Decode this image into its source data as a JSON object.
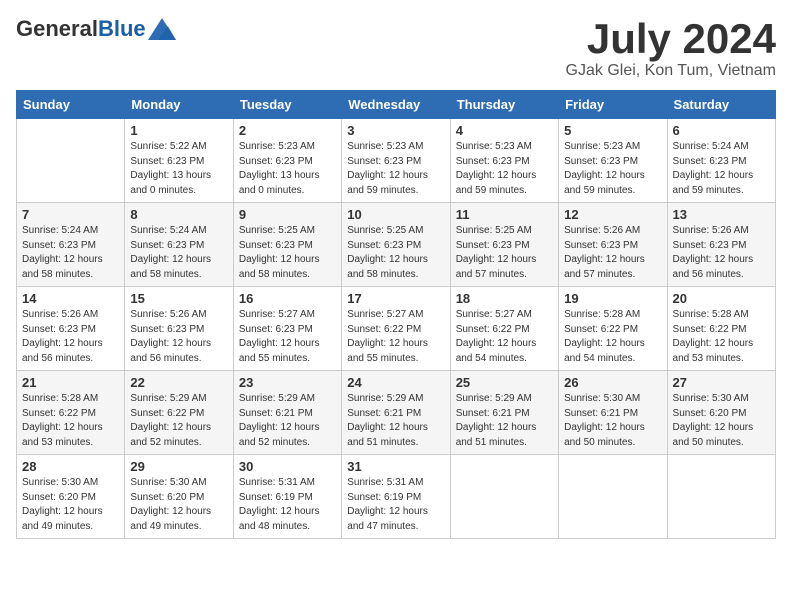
{
  "header": {
    "logo_general": "General",
    "logo_blue": "Blue",
    "month": "July 2024",
    "location": "GJak Glei, Kon Tum, Vietnam"
  },
  "weekdays": [
    "Sunday",
    "Monday",
    "Tuesday",
    "Wednesday",
    "Thursday",
    "Friday",
    "Saturday"
  ],
  "weeks": [
    [
      {
        "num": "",
        "info": ""
      },
      {
        "num": "1",
        "info": "Sunrise: 5:22 AM\nSunset: 6:23 PM\nDaylight: 13 hours\nand 0 minutes."
      },
      {
        "num": "2",
        "info": "Sunrise: 5:23 AM\nSunset: 6:23 PM\nDaylight: 13 hours\nand 0 minutes."
      },
      {
        "num": "3",
        "info": "Sunrise: 5:23 AM\nSunset: 6:23 PM\nDaylight: 12 hours\nand 59 minutes."
      },
      {
        "num": "4",
        "info": "Sunrise: 5:23 AM\nSunset: 6:23 PM\nDaylight: 12 hours\nand 59 minutes."
      },
      {
        "num": "5",
        "info": "Sunrise: 5:23 AM\nSunset: 6:23 PM\nDaylight: 12 hours\nand 59 minutes."
      },
      {
        "num": "6",
        "info": "Sunrise: 5:24 AM\nSunset: 6:23 PM\nDaylight: 12 hours\nand 59 minutes."
      }
    ],
    [
      {
        "num": "7",
        "info": "Sunrise: 5:24 AM\nSunset: 6:23 PM\nDaylight: 12 hours\nand 58 minutes."
      },
      {
        "num": "8",
        "info": "Sunrise: 5:24 AM\nSunset: 6:23 PM\nDaylight: 12 hours\nand 58 minutes."
      },
      {
        "num": "9",
        "info": "Sunrise: 5:25 AM\nSunset: 6:23 PM\nDaylight: 12 hours\nand 58 minutes."
      },
      {
        "num": "10",
        "info": "Sunrise: 5:25 AM\nSunset: 6:23 PM\nDaylight: 12 hours\nand 58 minutes."
      },
      {
        "num": "11",
        "info": "Sunrise: 5:25 AM\nSunset: 6:23 PM\nDaylight: 12 hours\nand 57 minutes."
      },
      {
        "num": "12",
        "info": "Sunrise: 5:26 AM\nSunset: 6:23 PM\nDaylight: 12 hours\nand 57 minutes."
      },
      {
        "num": "13",
        "info": "Sunrise: 5:26 AM\nSunset: 6:23 PM\nDaylight: 12 hours\nand 56 minutes."
      }
    ],
    [
      {
        "num": "14",
        "info": "Sunrise: 5:26 AM\nSunset: 6:23 PM\nDaylight: 12 hours\nand 56 minutes."
      },
      {
        "num": "15",
        "info": "Sunrise: 5:26 AM\nSunset: 6:23 PM\nDaylight: 12 hours\nand 56 minutes."
      },
      {
        "num": "16",
        "info": "Sunrise: 5:27 AM\nSunset: 6:23 PM\nDaylight: 12 hours\nand 55 minutes."
      },
      {
        "num": "17",
        "info": "Sunrise: 5:27 AM\nSunset: 6:22 PM\nDaylight: 12 hours\nand 55 minutes."
      },
      {
        "num": "18",
        "info": "Sunrise: 5:27 AM\nSunset: 6:22 PM\nDaylight: 12 hours\nand 54 minutes."
      },
      {
        "num": "19",
        "info": "Sunrise: 5:28 AM\nSunset: 6:22 PM\nDaylight: 12 hours\nand 54 minutes."
      },
      {
        "num": "20",
        "info": "Sunrise: 5:28 AM\nSunset: 6:22 PM\nDaylight: 12 hours\nand 53 minutes."
      }
    ],
    [
      {
        "num": "21",
        "info": "Sunrise: 5:28 AM\nSunset: 6:22 PM\nDaylight: 12 hours\nand 53 minutes."
      },
      {
        "num": "22",
        "info": "Sunrise: 5:29 AM\nSunset: 6:22 PM\nDaylight: 12 hours\nand 52 minutes."
      },
      {
        "num": "23",
        "info": "Sunrise: 5:29 AM\nSunset: 6:21 PM\nDaylight: 12 hours\nand 52 minutes."
      },
      {
        "num": "24",
        "info": "Sunrise: 5:29 AM\nSunset: 6:21 PM\nDaylight: 12 hours\nand 51 minutes."
      },
      {
        "num": "25",
        "info": "Sunrise: 5:29 AM\nSunset: 6:21 PM\nDaylight: 12 hours\nand 51 minutes."
      },
      {
        "num": "26",
        "info": "Sunrise: 5:30 AM\nSunset: 6:21 PM\nDaylight: 12 hours\nand 50 minutes."
      },
      {
        "num": "27",
        "info": "Sunrise: 5:30 AM\nSunset: 6:20 PM\nDaylight: 12 hours\nand 50 minutes."
      }
    ],
    [
      {
        "num": "28",
        "info": "Sunrise: 5:30 AM\nSunset: 6:20 PM\nDaylight: 12 hours\nand 49 minutes."
      },
      {
        "num": "29",
        "info": "Sunrise: 5:30 AM\nSunset: 6:20 PM\nDaylight: 12 hours\nand 49 minutes."
      },
      {
        "num": "30",
        "info": "Sunrise: 5:31 AM\nSunset: 6:19 PM\nDaylight: 12 hours\nand 48 minutes."
      },
      {
        "num": "31",
        "info": "Sunrise: 5:31 AM\nSunset: 6:19 PM\nDaylight: 12 hours\nand 47 minutes."
      },
      {
        "num": "",
        "info": ""
      },
      {
        "num": "",
        "info": ""
      },
      {
        "num": "",
        "info": ""
      }
    ]
  ]
}
